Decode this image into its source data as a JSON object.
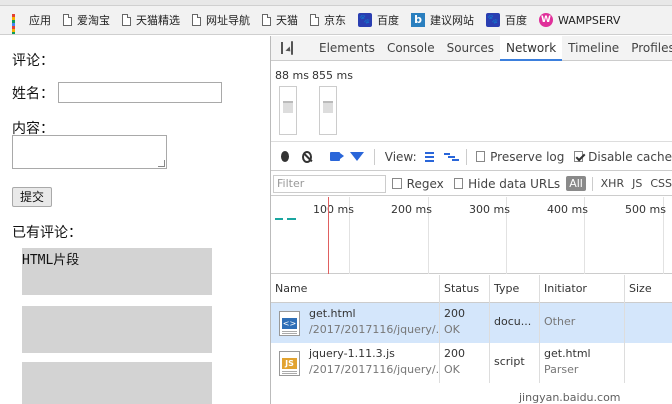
{
  "bookmarks": {
    "items": [
      {
        "label": "应用",
        "icon": "apps-grid-icon"
      },
      {
        "label": "爱淘宝",
        "icon": "page-icon"
      },
      {
        "label": "天猫精选",
        "icon": "page-icon"
      },
      {
        "label": "网址导航",
        "icon": "page-icon"
      },
      {
        "label": "天猫",
        "icon": "page-icon"
      },
      {
        "label": "京东",
        "icon": "page-icon"
      },
      {
        "label": "百度",
        "icon": "baidu-paw-icon"
      },
      {
        "label": "建议网站",
        "icon": "bing-icon"
      },
      {
        "label": "百度",
        "icon": "baidu-paw-icon"
      },
      {
        "label": "WAMPSERV",
        "icon": "wampserver-icon"
      }
    ]
  },
  "page": {
    "comment_heading": "评论：",
    "name_label": "姓名：",
    "content_label": "内容：",
    "submit_label": "提交",
    "existing_heading": "已有评论：",
    "comment_boxes": [
      "HTML片段",
      "",
      ""
    ]
  },
  "devtools": {
    "tabs": [
      "Elements",
      "Console",
      "Sources",
      "Network",
      "Timeline",
      "Profiles"
    ],
    "active_tab": "Network",
    "filmstrip": [
      "88 ms",
      "855 ms"
    ],
    "toolbar": {
      "view_label": "View:",
      "preserve_log": "Preserve log",
      "disable_cache": "Disable cache"
    },
    "filter": {
      "placeholder": "Filter",
      "regex": "Regex",
      "hide_data_urls": "Hide data URLs",
      "all": "All",
      "types": [
        "XHR",
        "JS",
        "CSS"
      ]
    },
    "timeline_ticks": [
      "100 ms",
      "200 ms",
      "300 ms",
      "400 ms",
      "500 ms"
    ],
    "columns": [
      "Name",
      "Status",
      "Type",
      "Initiator",
      "Size"
    ],
    "requests": [
      {
        "name": "get.html",
        "path": "/2017/2017116/jquery/...",
        "status": "200",
        "status_text": "OK",
        "type": "docu...",
        "initiator": "Other",
        "initiator2": "",
        "file_type": "html"
      },
      {
        "name": "jquery-1.11.3.js",
        "path": "/2017/2017116/jquery/...",
        "status": "200",
        "status_text": "OK",
        "type": "script",
        "initiator": "get.html",
        "initiator2": "Parser",
        "file_type": "js"
      }
    ],
    "watermark": "jingyan.baidu.com"
  }
}
